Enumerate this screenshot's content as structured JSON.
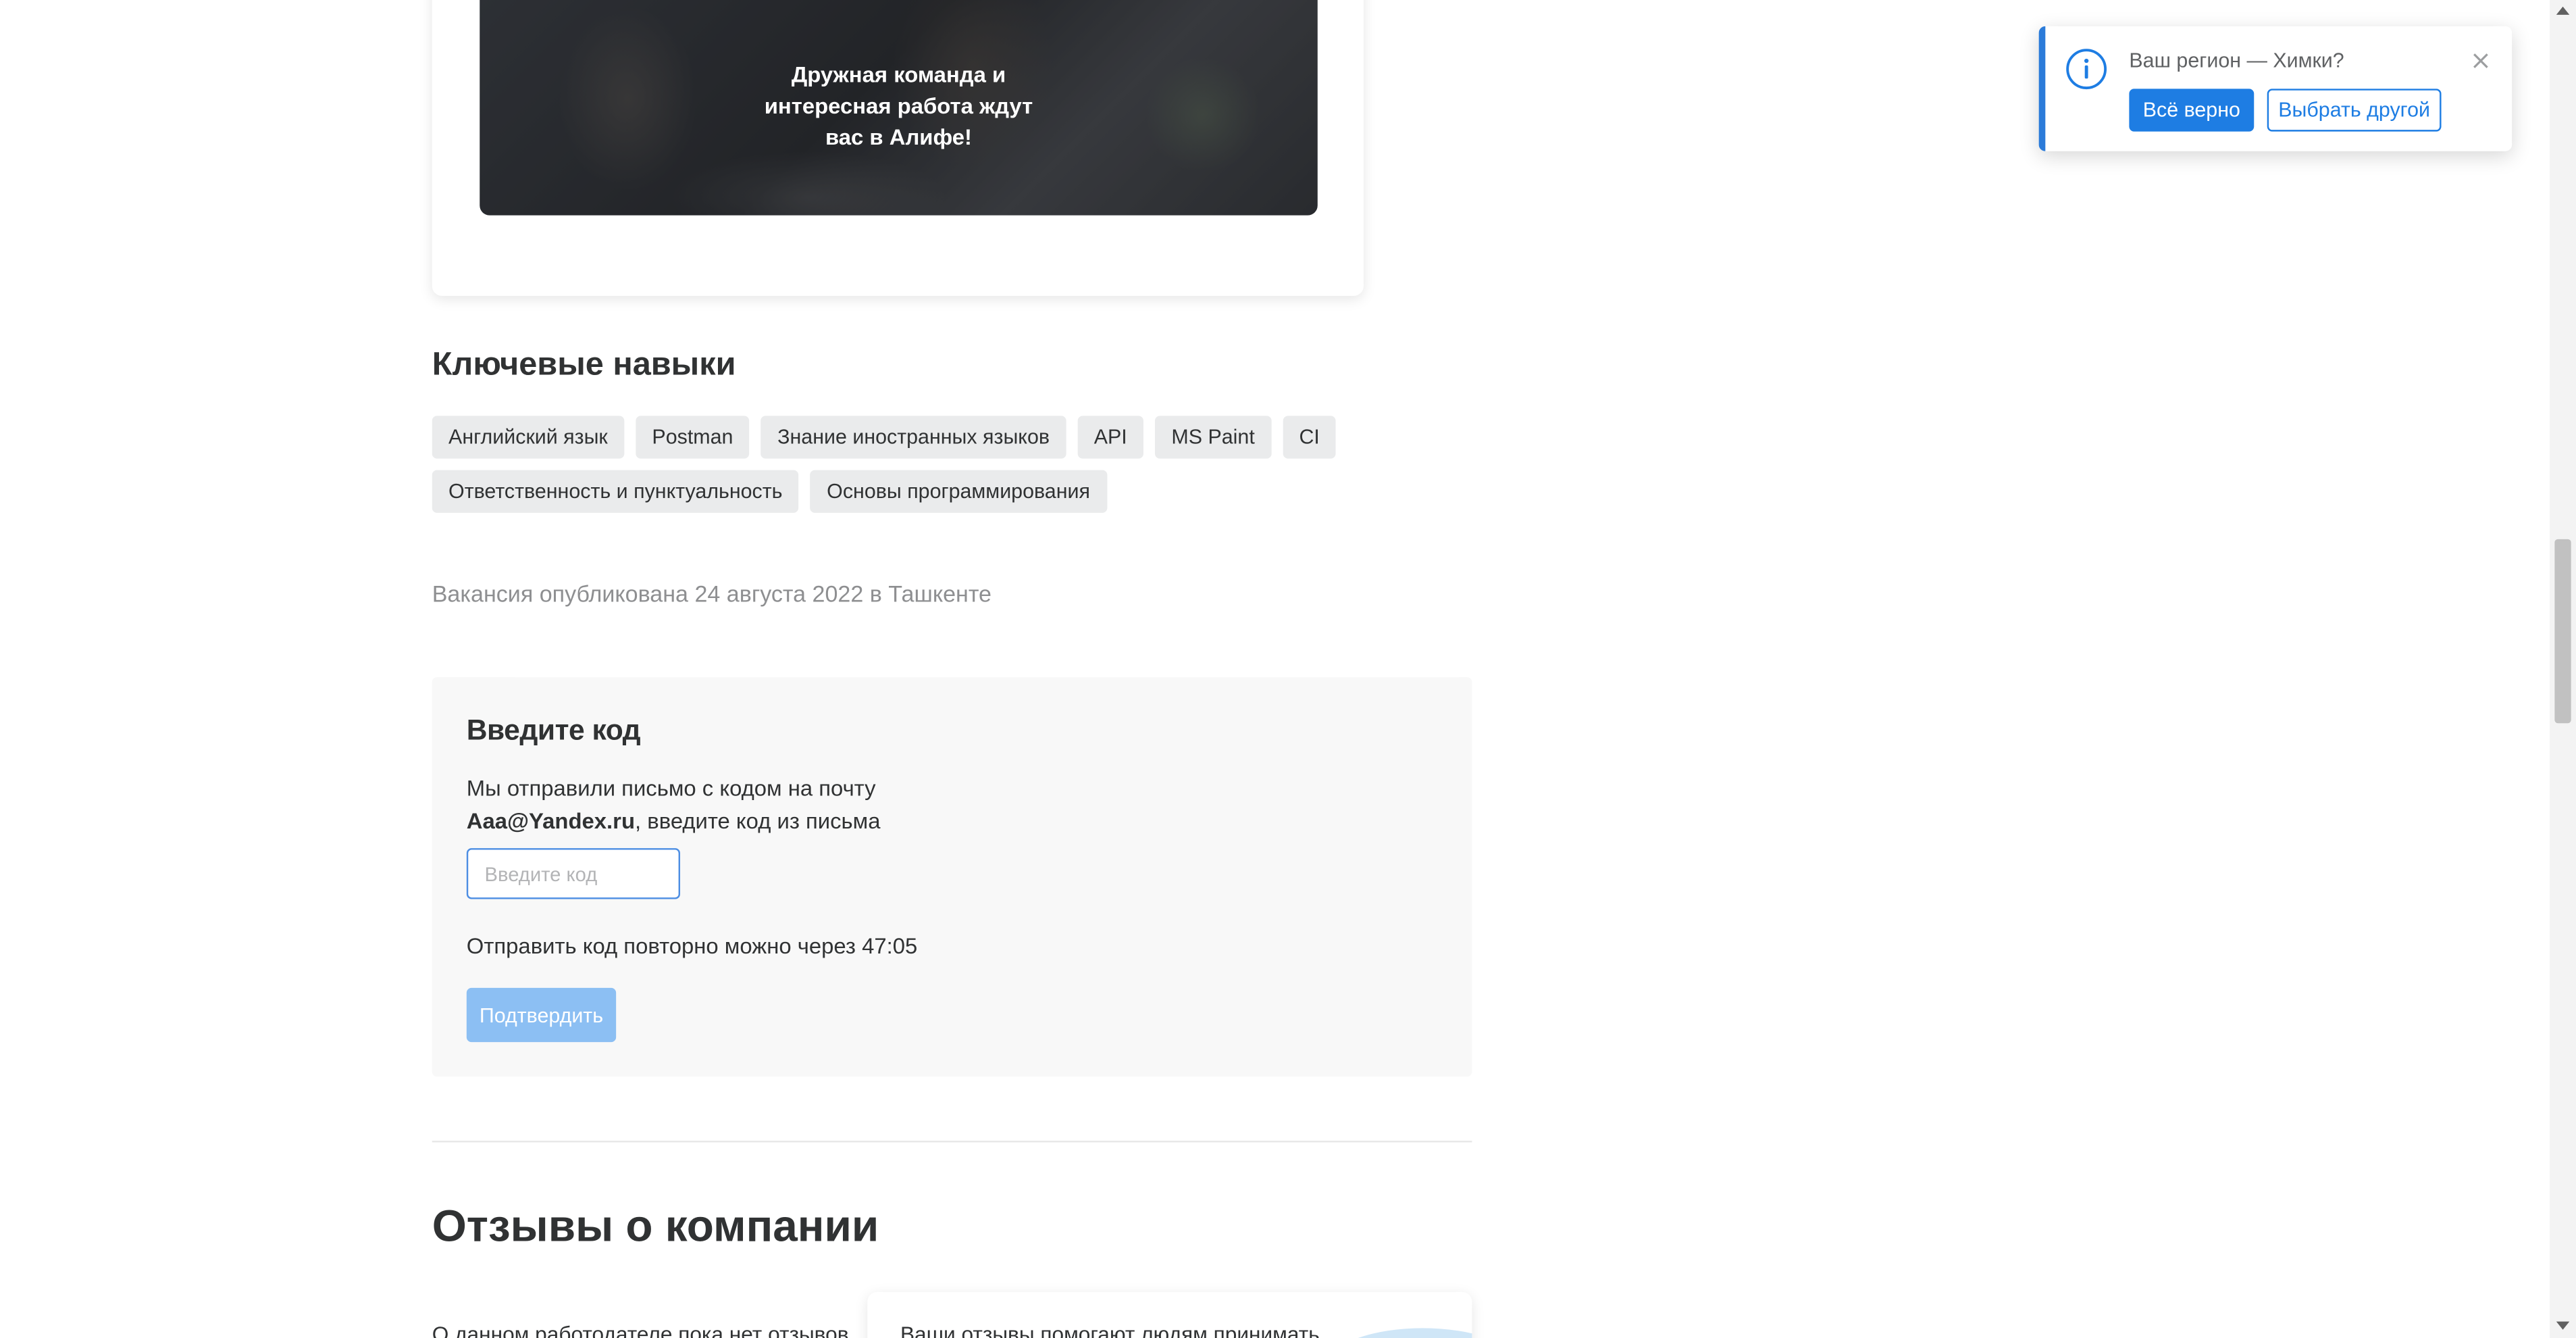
{
  "banner": {
    "text": "Дружная команда и интересная работа ждут вас в Алифе!"
  },
  "skills": {
    "title": "Ключевые навыки",
    "tags": [
      "Английский язык",
      "Postman",
      "Знание иностранных языков",
      "API",
      "MS Paint",
      "CI",
      "Ответственность и пунктуальность",
      "Основы программирования"
    ]
  },
  "vacancy": {
    "published": "Вакансия опубликована 24 августа 2022 в Ташкенте"
  },
  "code_form": {
    "title": "Введите код",
    "desc_line1": "Мы отправили письмо с кодом на почту",
    "email": "Aaa@Yandex.ru",
    "desc_line2_suffix": ", введите код из письма",
    "input_placeholder": "Введите код",
    "input_value": "",
    "resend_text": "Отправить код повторно можно через 47:05",
    "confirm_label": "Подтвердить"
  },
  "reviews": {
    "title": "Отзывы о компании",
    "empty_text": "О данном работодателе пока нет отзывов",
    "card_text": "Ваши отзывы помогают людям принимать"
  },
  "region_toast": {
    "question": "Ваш регион — Химки?",
    "confirm_label": "Всё верно",
    "choose_label": "Выбрать другой",
    "close_icon": "close-icon",
    "info_icon": "info-icon"
  },
  "colors": {
    "accent": "#1e7de3",
    "confirm_disabled": "#8cbff3",
    "tag_bg": "#eaebec"
  }
}
